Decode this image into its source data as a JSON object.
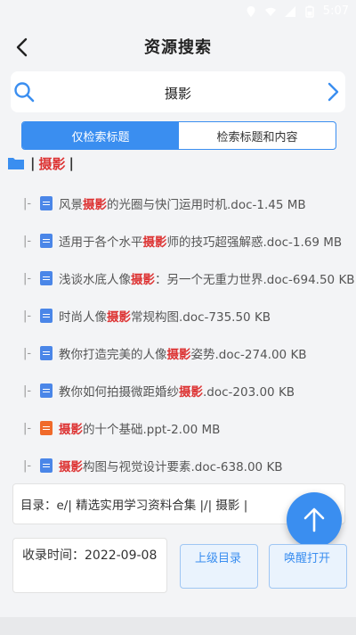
{
  "status_bar": {
    "time": "5:07"
  },
  "header": {
    "title": "资源搜索",
    "back_icon": "chevron-left-icon"
  },
  "search": {
    "value": "摄影",
    "icon": "search-icon",
    "go_icon": "chevron-right-icon"
  },
  "tabs": [
    {
      "label": "仅检索标题",
      "active": true
    },
    {
      "label": "检索标题和内容",
      "active": false
    }
  ],
  "folder": {
    "pipe_left": "|",
    "name": "摄影",
    "pipe_right": "|"
  },
  "files": [
    {
      "prefix": "|-",
      "type": "doc",
      "before": "风景",
      "keyword": "摄影",
      "after": "的光圈与快门运用时机.doc-1.45 MB"
    },
    {
      "prefix": "|-",
      "type": "doc",
      "before": "适用于各个水平",
      "keyword": "摄影",
      "after": "师的技巧超强解惑.doc-1.69 MB"
    },
    {
      "prefix": "|-",
      "type": "doc",
      "before": "浅谈水底人像",
      "keyword": "摄影",
      "after": "：另一个无重力世界.doc-694.50 KB"
    },
    {
      "prefix": "|-",
      "type": "doc",
      "before": "时尚人像",
      "keyword": "摄影",
      "after": "常规构图.doc-735.50 KB"
    },
    {
      "prefix": "|-",
      "type": "doc",
      "before": "教你打造完美的人像",
      "keyword": "摄影",
      "after": "姿势.doc-274.00 KB"
    },
    {
      "prefix": "|-",
      "type": "doc",
      "before": "教你如何拍摄微距婚纱",
      "keyword": "摄影",
      "after": ".doc-203.00 KB"
    },
    {
      "prefix": "|-",
      "type": "ppt",
      "before": "",
      "keyword": "摄影",
      "after": "的十个基础.ppt-2.00 MB"
    },
    {
      "prefix": "|-",
      "type": "doc",
      "before": "",
      "keyword": "摄影",
      "after": "构图与视觉设计要素.doc-638.00 KB"
    }
  ],
  "directory": {
    "text": "目录：e/| 精选实用学习资料合集 |/| 摄影 |"
  },
  "record": {
    "label": "收录时间：",
    "date": "2022-09-08"
  },
  "buttons": {
    "parent_dir": "上级目录",
    "wake_open": "唤醒打开"
  },
  "colors": {
    "accent": "#3a8ef0",
    "keyword": "#dd3333"
  }
}
